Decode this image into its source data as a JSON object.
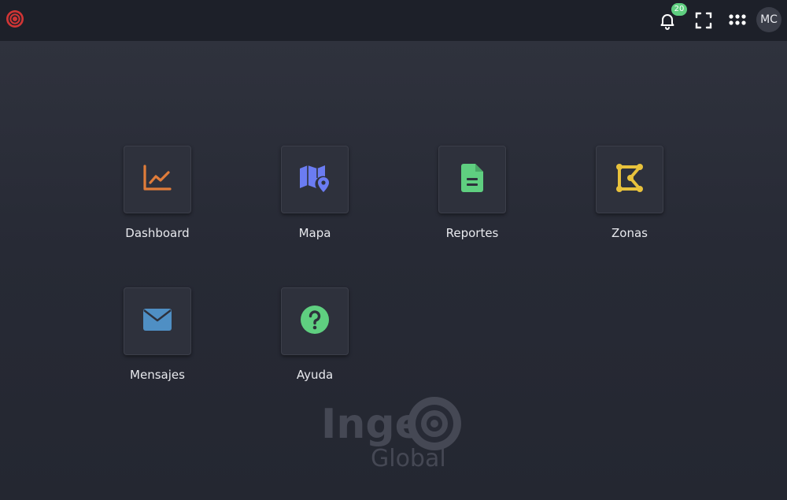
{
  "header": {
    "notifications_count": "20",
    "user_initials": "MC"
  },
  "apps": [
    {
      "label": "Dashboard",
      "icon": "chart-line-icon",
      "color": "#e07c3a"
    },
    {
      "label": "Mapa",
      "icon": "map-location-icon",
      "color": "#6b7cf2"
    },
    {
      "label": "Reportes",
      "icon": "document-icon",
      "color": "#5fcf80"
    },
    {
      "label": "Zonas",
      "icon": "polygon-icon",
      "color": "#e8c23c"
    },
    {
      "label": "Mensajes",
      "icon": "envelope-icon",
      "color": "#4f8fc4"
    },
    {
      "label": "Ayuda",
      "icon": "question-circle-icon",
      "color": "#5fcf80"
    }
  ],
  "watermark": {
    "line1": "Inge",
    "line2": "Global"
  }
}
